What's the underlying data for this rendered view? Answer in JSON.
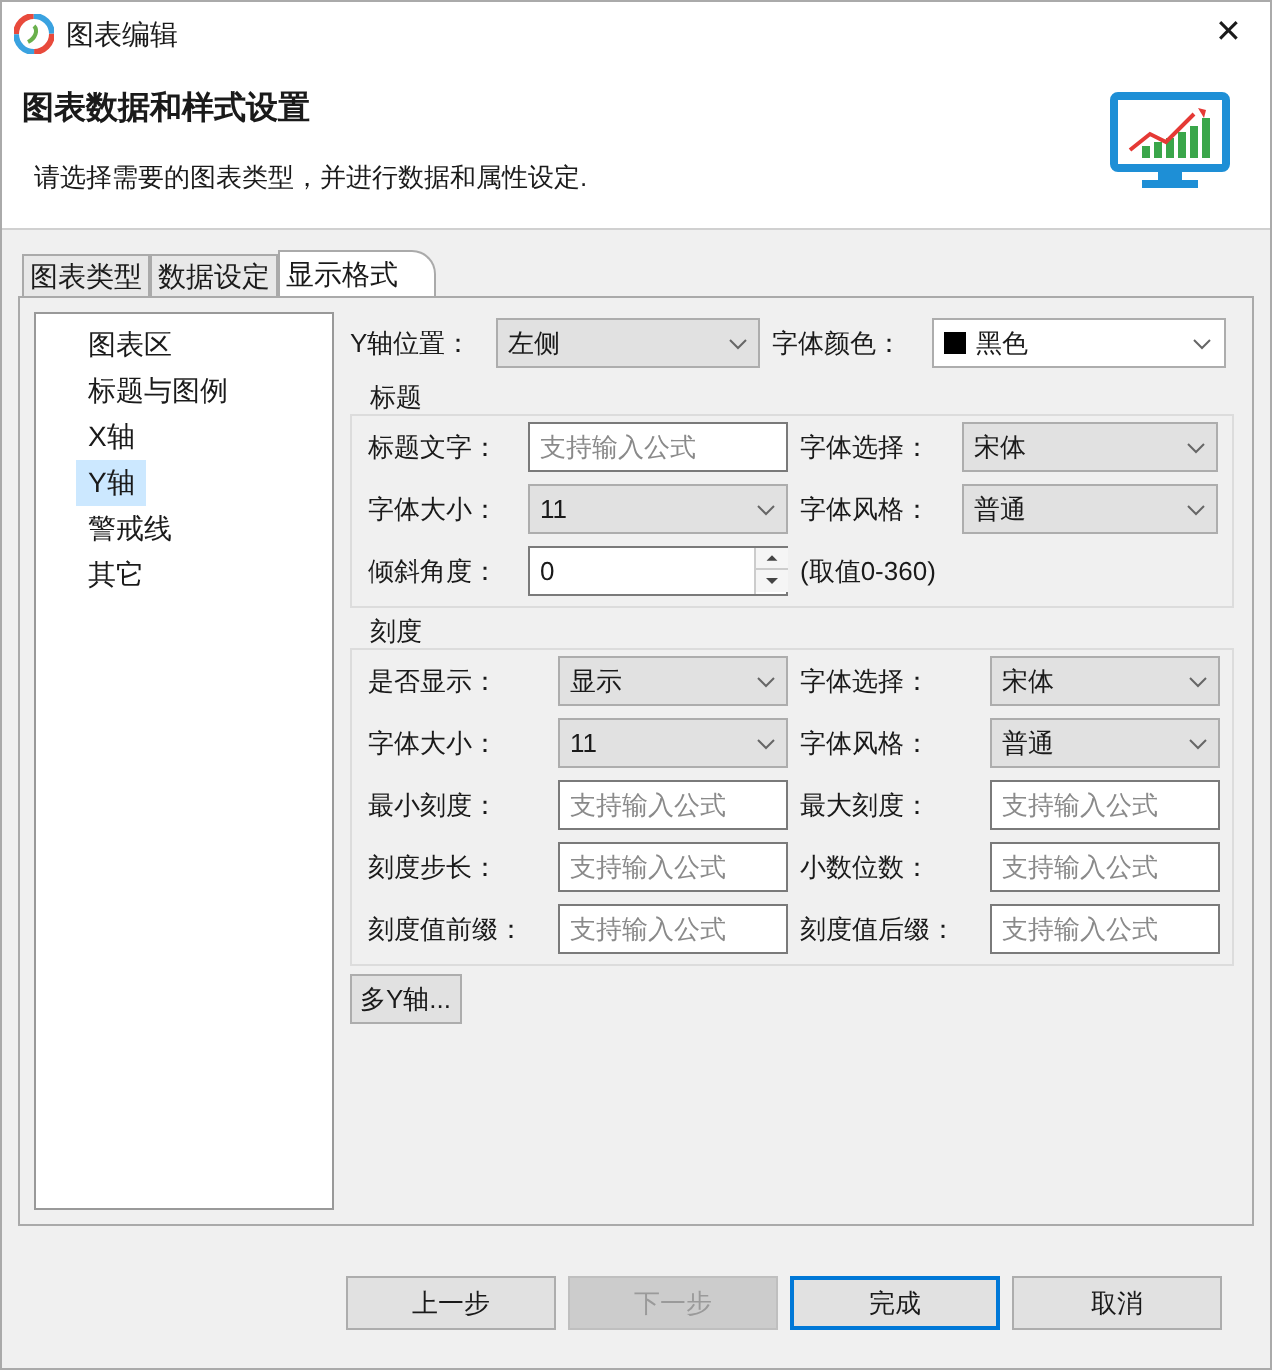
{
  "window": {
    "title": "图表编辑",
    "close": "✕"
  },
  "header": {
    "title": "图表数据和样式设置",
    "subtitle": "请选择需要的图表类型，并进行数据和属性设定."
  },
  "tabs": [
    {
      "label": "图表类型",
      "selected": false
    },
    {
      "label": "数据设定",
      "selected": false
    },
    {
      "label": "显示格式",
      "selected": true
    }
  ],
  "sidebar": {
    "items": [
      {
        "label": "图表区",
        "selected": false
      },
      {
        "label": "标题与图例",
        "selected": false
      },
      {
        "label": "X轴",
        "selected": false
      },
      {
        "label": "Y轴",
        "selected": true
      },
      {
        "label": "警戒线",
        "selected": false
      },
      {
        "label": "其它",
        "selected": false
      }
    ]
  },
  "axis_row": [
    {
      "kind": "pair",
      "label": "Y轴位置：",
      "field": {
        "kind": "select",
        "value": "左侧"
      }
    },
    {
      "kind": "pair",
      "label": "字体颜色：",
      "field": {
        "kind": "color-select",
        "value": "黑色",
        "color": "#000000"
      }
    }
  ],
  "groups": [
    {
      "heading": "标题",
      "rows": [
        [
          {
            "kind": "pair",
            "label": "标题文字：",
            "field": {
              "kind": "text",
              "placeholder": "支持输入公式"
            }
          },
          {
            "kind": "pair",
            "label": "字体选择：",
            "field": {
              "kind": "select",
              "value": "宋体"
            }
          }
        ],
        [
          {
            "kind": "pair",
            "label": "字体大小：",
            "field": {
              "kind": "select",
              "value": "11"
            }
          },
          {
            "kind": "pair",
            "label": "字体风格：",
            "field": {
              "kind": "select",
              "value": "普通"
            }
          }
        ],
        [
          {
            "kind": "pair",
            "label": "倾斜角度：",
            "field": {
              "kind": "spinner",
              "value": "0"
            }
          },
          {
            "kind": "note",
            "text": "(取值0-360)"
          }
        ]
      ]
    },
    {
      "heading": "刻度",
      "rows": [
        [
          {
            "kind": "pair",
            "label": "是否显示：",
            "field": {
              "kind": "select",
              "value": "显示"
            }
          },
          {
            "kind": "pair",
            "label": "字体选择：",
            "field": {
              "kind": "select",
              "value": "宋体"
            }
          }
        ],
        [
          {
            "kind": "pair",
            "label": "字体大小：",
            "field": {
              "kind": "select",
              "value": "11"
            }
          },
          {
            "kind": "pair",
            "label": "字体风格：",
            "field": {
              "kind": "select",
              "value": "普通"
            }
          }
        ],
        [
          {
            "kind": "pair",
            "label": "最小刻度：",
            "field": {
              "kind": "text",
              "placeholder": "支持输入公式"
            }
          },
          {
            "kind": "pair",
            "label": "最大刻度：",
            "field": {
              "kind": "text",
              "placeholder": "支持输入公式"
            }
          }
        ],
        [
          {
            "kind": "pair",
            "label": "刻度步长：",
            "field": {
              "kind": "text",
              "placeholder": "支持输入公式"
            }
          },
          {
            "kind": "pair",
            "label": "小数位数：",
            "field": {
              "kind": "text",
              "placeholder": "支持输入公式"
            }
          }
        ],
        [
          {
            "kind": "pair",
            "label": "刻度值前缀：",
            "field": {
              "kind": "text",
              "placeholder": "支持输入公式"
            }
          },
          {
            "kind": "pair",
            "label": "刻度值后缀：",
            "field": {
              "kind": "text",
              "placeholder": "支持输入公式"
            }
          }
        ]
      ]
    }
  ],
  "multi_axis_button": {
    "label": "多Y轴..."
  },
  "buttons": [
    {
      "label": "上一步",
      "disabled": false,
      "default": false
    },
    {
      "label": "下一步",
      "disabled": true,
      "default": false
    },
    {
      "label": "完成",
      "disabled": false,
      "default": true
    },
    {
      "label": "取消",
      "disabled": false,
      "default": false
    }
  ]
}
